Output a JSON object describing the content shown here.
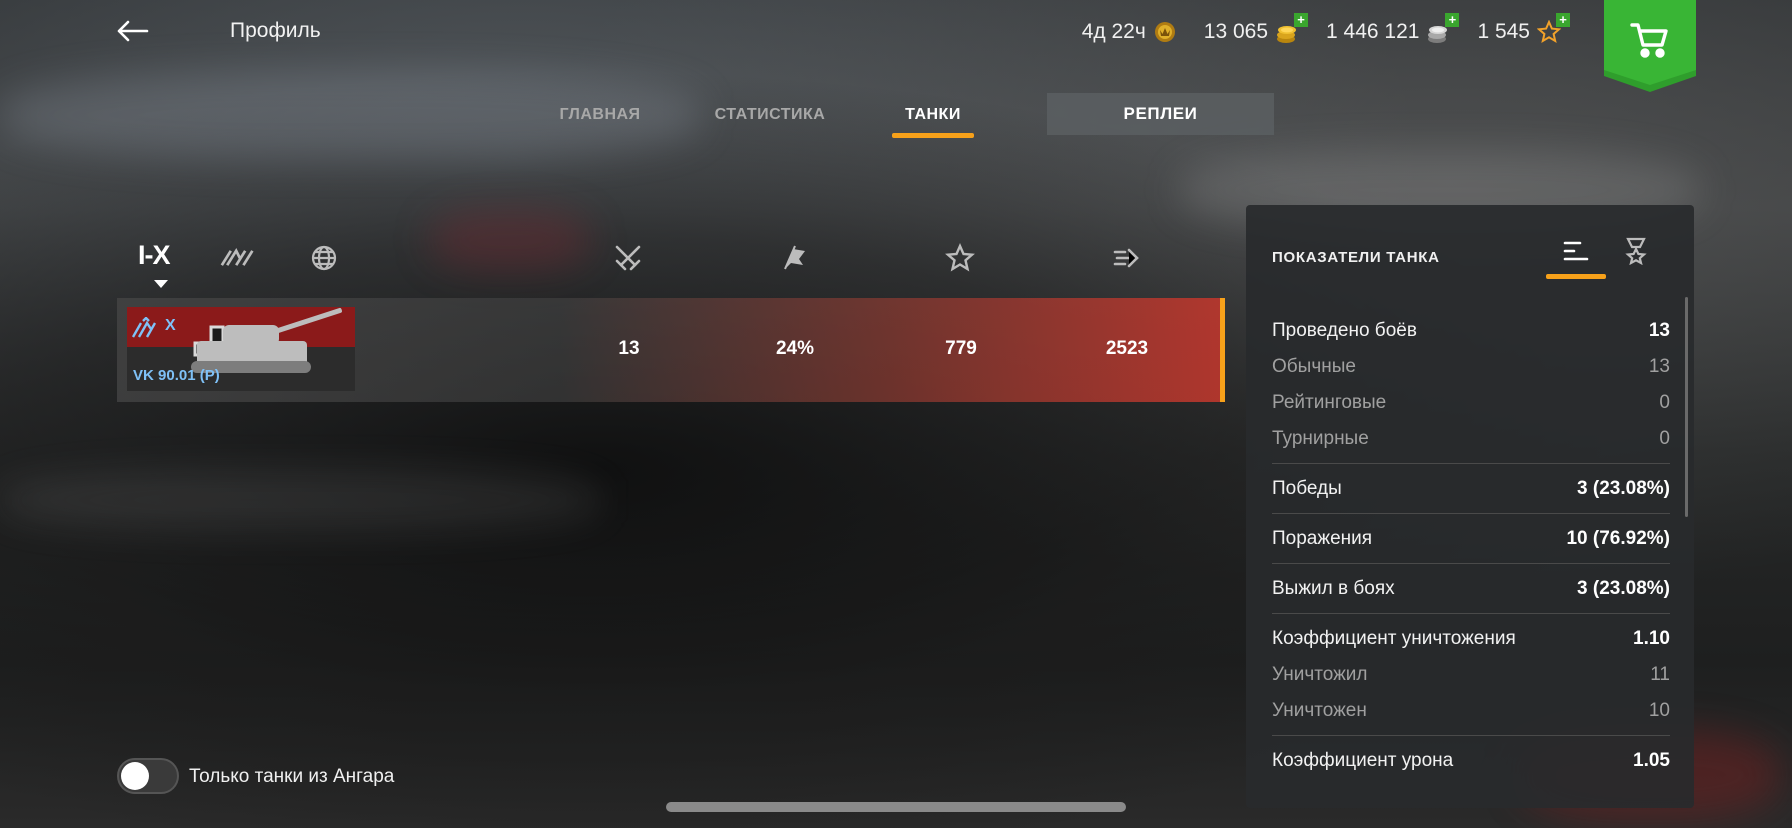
{
  "header": {
    "title": "Профиль",
    "currencies": [
      {
        "name": "premium-time",
        "value": "4д 22ч",
        "icon": "premium-crown-icon",
        "color": "#d8a21f"
      },
      {
        "name": "gold",
        "value": "13 065",
        "icon": "gold-coins-icon",
        "color": "#e3b323"
      },
      {
        "name": "credits",
        "value": "1 446 121",
        "icon": "silver-coins-icon",
        "color": "#c8c8c8"
      },
      {
        "name": "free-xp",
        "value": "1 545",
        "icon": "star-xp-icon",
        "color": "#f2a22a"
      }
    ],
    "shop_icon": "cart-icon"
  },
  "tabs": [
    {
      "label": "ГЛАВНАЯ",
      "active": false
    },
    {
      "label": "СТАТИСТИКА",
      "active": false
    },
    {
      "label": "ТАНКИ",
      "active": true
    }
  ],
  "replay_button": "РЕПЛЕИ",
  "filters": {
    "tier": "I-X",
    "icons": [
      "vehicle-type-icon",
      "nation-globe-icon",
      "battles-swords-icon",
      "winrate-flag-icon",
      "mastery-star-icon",
      "damage-shell-icon"
    ]
  },
  "tank": {
    "tier": "X",
    "name": "VK 90.01 (P)",
    "battles": "13",
    "winrate": "24%",
    "xp": "779",
    "damage": "2523"
  },
  "toggle": {
    "label": "Только танки из Ангара",
    "on": false
  },
  "panel": {
    "title": "ПОКАЗАТЕЛИ ТАНКА",
    "stats": [
      {
        "k": "Проведено боёв",
        "v": "13",
        "type": "major"
      },
      {
        "k": "Обычные",
        "v": "13",
        "type": "sub"
      },
      {
        "k": "Рейтинговые",
        "v": "0",
        "type": "sub"
      },
      {
        "k": "Турнирные",
        "v": "0",
        "type": "sub"
      },
      {
        "k": "Победы",
        "v": "3 (23.08%)",
        "type": "major"
      },
      {
        "k": "Поражения",
        "v": "10 (76.92%)",
        "type": "major"
      },
      {
        "k": "Выжил в боях",
        "v": "3 (23.08%)",
        "type": "major"
      },
      {
        "k": "Коэффициент уничтожения",
        "v": "1.10",
        "type": "major"
      },
      {
        "k": "Уничтожил",
        "v": "11",
        "type": "sub"
      },
      {
        "k": "Уничтожен",
        "v": "10",
        "type": "sub"
      },
      {
        "k": "Коэффициент урона",
        "v": "1.05",
        "type": "major"
      }
    ]
  },
  "colors": {
    "accent": "#f7a11a",
    "tank_text": "#7fc1f7",
    "shop": "#2f9e2c"
  }
}
